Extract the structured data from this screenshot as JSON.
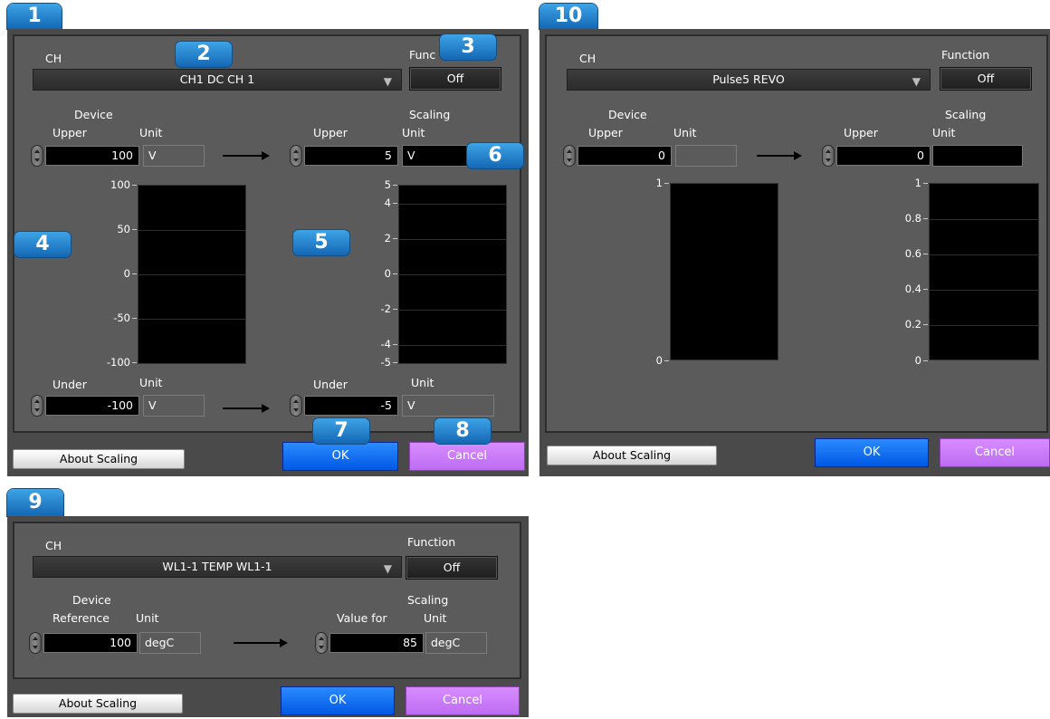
{
  "panel1": {
    "badge": "1",
    "ch_label": "CH",
    "ch_value": "CH1 DC  CH 1",
    "function_label": "Func",
    "function_value": "Off",
    "device_label": "Device",
    "device_upper_label": "Upper",
    "device_unit_label": "Unit",
    "device_upper_value": "100",
    "device_upper_unit": "V",
    "scaling_label": "Scaling",
    "scaling_upper_label": "Upper",
    "scaling_unit_label": "Unit",
    "scaling_upper_value": "5",
    "scaling_upper_unit": "V",
    "device_ticks": [
      "100",
      "50",
      "0",
      "-50",
      "-100"
    ],
    "scaling_ticks": [
      "5",
      "4",
      "2",
      "0",
      "-2",
      "-4",
      "-5"
    ],
    "device_under_label": "Under",
    "device_under_unit_label": "Unit",
    "device_under_value": "-100",
    "device_under_unit": "V",
    "scaling_under_label": "Under",
    "scaling_under_unit_label": "Unit",
    "scaling_under_value": "-5",
    "scaling_under_unit": "V",
    "about_label": "About Scaling",
    "ok_label": "OK",
    "cancel_label": "Cancel",
    "callouts": [
      "2",
      "3",
      "4",
      "5",
      "6",
      "7",
      "8"
    ]
  },
  "panel10": {
    "badge": "10",
    "ch_label": "CH",
    "ch_value": "Pulse5 REVO",
    "function_label": "Function",
    "function_value": "Off",
    "device_label": "Device",
    "device_upper_label": "Upper",
    "device_unit_label": "Unit",
    "device_upper_value": "0",
    "device_upper_unit": "",
    "scaling_label": "Scaling",
    "scaling_upper_label": "Upper",
    "scaling_unit_label": "Unit",
    "scaling_upper_value": "0",
    "scaling_upper_unit": "",
    "device_ticks": [
      "1",
      "0"
    ],
    "scaling_ticks": [
      "1",
      "0.8",
      "0.6",
      "0.4",
      "0.2",
      "0"
    ],
    "about_label": "About Scaling",
    "ok_label": "OK",
    "cancel_label": "Cancel"
  },
  "panel9": {
    "badge": "9",
    "ch_label": "CH",
    "ch_value": "WL1-1 TEMP  WL1-1",
    "function_label": "Function",
    "function_value": "Off",
    "device_label": "Device",
    "device_ref_label": "Reference",
    "device_unit_label": "Unit",
    "device_ref_value": "100",
    "device_ref_unit": "degC",
    "scaling_label": "Scaling",
    "scaling_value_label": "Value for",
    "scaling_unit_label": "Unit",
    "scaling_value": "85",
    "scaling_unit": "degC",
    "about_label": "About Scaling",
    "ok_label": "OK",
    "cancel_label": "Cancel"
  },
  "colors": {
    "badge": "#1f7fd0",
    "ok": "#0a6cf0",
    "cancel": "#c97af5",
    "panel": "#4a4a4a"
  }
}
